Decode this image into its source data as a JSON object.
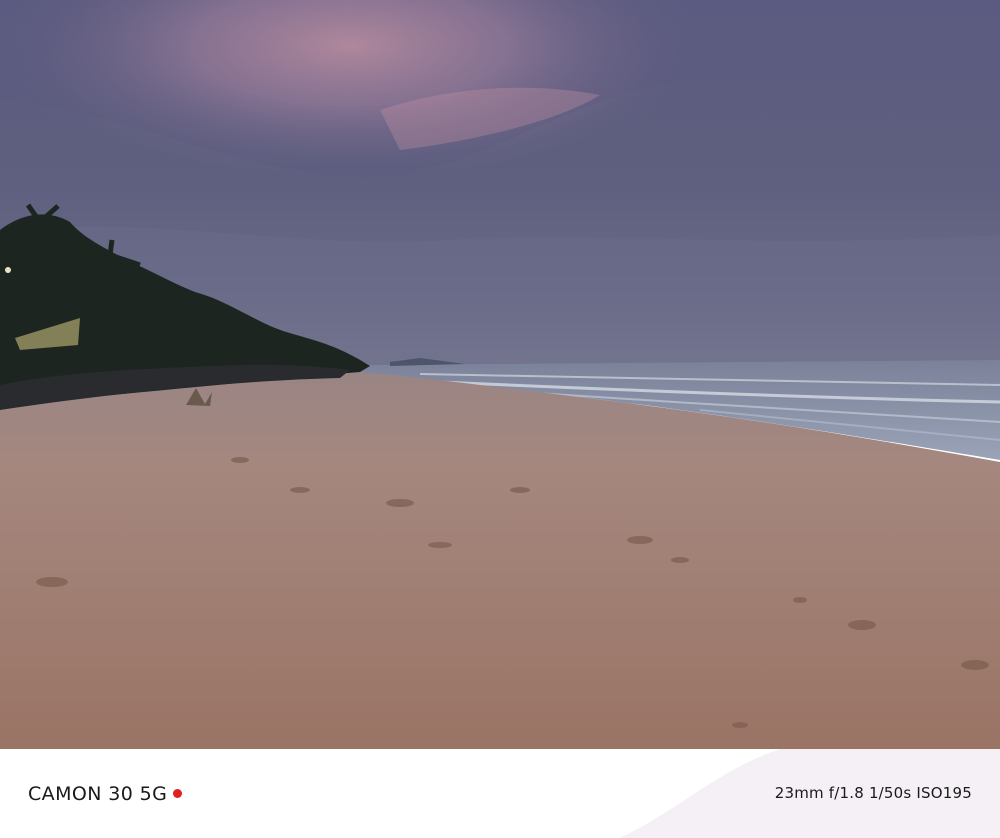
{
  "photo": {
    "subject": "Beach at dusk with palm trees, waves and footprints in sand",
    "colors": {
      "sky_top": "#5c5a7e",
      "sky_pink": "#d79aa8",
      "sky_low": "#6a6b8b",
      "sea": "#8c97ad",
      "sand_far": "#a88a84",
      "sand_near": "#9e7768",
      "trees": "#1d2620"
    }
  },
  "caption": {
    "model": "CAMON 30 5G",
    "model_dot_color": "#e02020",
    "exif": "23mm  f/1.8  1/50s  ISO195"
  }
}
